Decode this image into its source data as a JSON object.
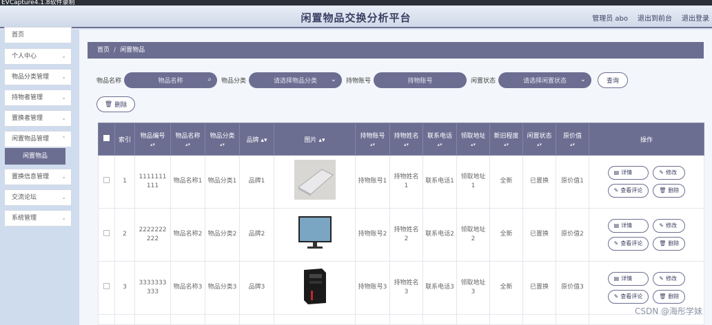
{
  "capture_bar": "EVCapture4.1.8软件录制",
  "header": {
    "title": "闲置物品交换分析平台",
    "links": [
      "管理员 abo",
      "退出到前台",
      "退出登录"
    ]
  },
  "sidebar": {
    "home": "首页",
    "items": [
      "个人中心",
      "物品分类管理",
      "持物者管理",
      "置换者管理",
      "闲置物品管理",
      "置换信息管理",
      "交流论坛",
      "系统管理"
    ],
    "active_sub": "闲置物品"
  },
  "breadcrumb": {
    "home": "首页",
    "sep": "/",
    "current": "闲置物品"
  },
  "filters": [
    {
      "label": "物品名称",
      "placeholder": "物品名称",
      "icon": "search-icon"
    },
    {
      "label": "物品分类",
      "placeholder": "请选择物品分类",
      "icon": "chevron-down-icon"
    },
    {
      "label": "持物账号",
      "placeholder": "持物账号",
      "icon": ""
    },
    {
      "label": "闲置状态",
      "placeholder": "请选择闲置状态",
      "icon": "chevron-down-icon"
    }
  ],
  "query_label": "查询",
  "delete_label": "删除",
  "table": {
    "headers": [
      "索引",
      "物品编号",
      "物品名称",
      "物品分类",
      "品牌",
      "图片",
      "持物账号",
      "持物姓名",
      "联系电话",
      "领取地址",
      "新旧程度",
      "闲置状态",
      "原价值",
      "操作"
    ],
    "rows": [
      {
        "index": "1",
        "code": "1111111111",
        "name": "物品名称1",
        "category": "物品分类1",
        "brand": "品牌1",
        "img": "laptop",
        "account": "持物账号1",
        "holder": "持物姓名1",
        "phone": "联系电话1",
        "address": "领取地址1",
        "condition": "全新",
        "status": "已置换",
        "value": "原价值1"
      },
      {
        "index": "2",
        "code": "2222222222",
        "name": "物品名称2",
        "category": "物品分类2",
        "brand": "品牌2",
        "img": "monitor",
        "account": "持物账号2",
        "holder": "持物姓名2",
        "phone": "联系电话2",
        "address": "领取地址2",
        "condition": "全新",
        "status": "已置换",
        "value": "原价值2"
      },
      {
        "index": "3",
        "code": "3333333333",
        "name": "物品名称3",
        "category": "物品分类3",
        "brand": "品牌3",
        "img": "pc-tower",
        "account": "持物账号3",
        "holder": "持物姓名3",
        "phone": "联系电话3",
        "address": "领取地址3",
        "condition": "全新",
        "status": "已置换",
        "value": "原价值3"
      }
    ],
    "ops": [
      "详情",
      "修改",
      "查看评论",
      "删除"
    ]
  },
  "watermark": "CSDN @海彤学妹",
  "colors": {
    "primary": "#6b6d91",
    "sidebar_bg": "#cfdcee",
    "content_bg": "#f3f6fa"
  }
}
